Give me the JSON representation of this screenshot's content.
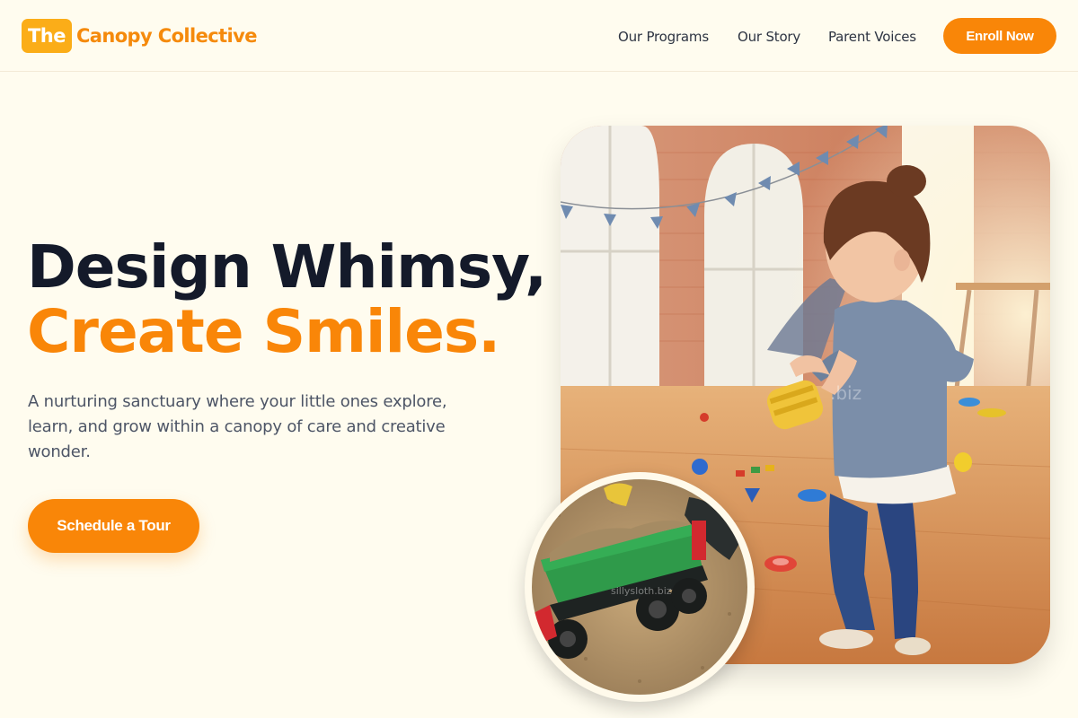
{
  "brand": {
    "badge": "The",
    "name": "Canopy Collective",
    "accent_color": "#f98608",
    "badge_color": "#fbad18"
  },
  "nav": {
    "links": [
      "Our Programs",
      "Our Story",
      "Parent Voices"
    ],
    "cta": "Enroll Now"
  },
  "hero": {
    "title_line1": "Design Whimsy,",
    "title_line2": "Create Smiles.",
    "subtitle": "A nurturing sanctuary where your little ones explore, learn, and grow within a canopy of care and creative wonder.",
    "cta": "Schedule a Tour"
  },
  "images": {
    "main": "photo of a toddler girl playing with toy cups in a sunlit playroom",
    "inset": "circular photo of a green toy dump truck filled with sand"
  }
}
